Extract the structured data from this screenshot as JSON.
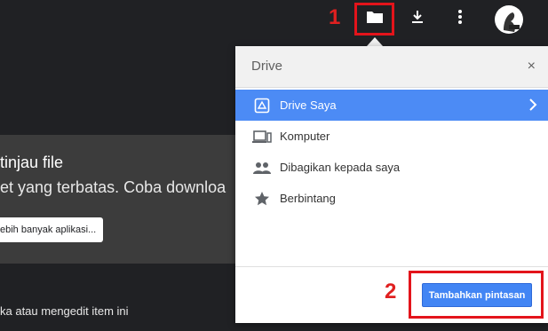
{
  "annotations": {
    "step1": "1",
    "step2": "2"
  },
  "background": {
    "title": "tinjau file",
    "subtitle": "et yang terbatas. Coba downloa",
    "more_apps_button": "ebih banyak aplikasi...",
    "bottom_text": "ka atau mengedit item ini"
  },
  "panel": {
    "title": "Drive",
    "close": "×",
    "items": [
      {
        "label": "Drive Saya",
        "icon": "drive-icon",
        "active": true
      },
      {
        "label": "Komputer",
        "icon": "computer-icon"
      },
      {
        "label": "Dibagikan kepada saya",
        "icon": "shared-people-icon"
      },
      {
        "label": "Berbintang",
        "icon": "star-icon"
      }
    ],
    "add_shortcut_button": "Tambahkan pintasan"
  },
  "colors": {
    "accent": "#4c8bf5",
    "highlight": "#e3141b"
  }
}
